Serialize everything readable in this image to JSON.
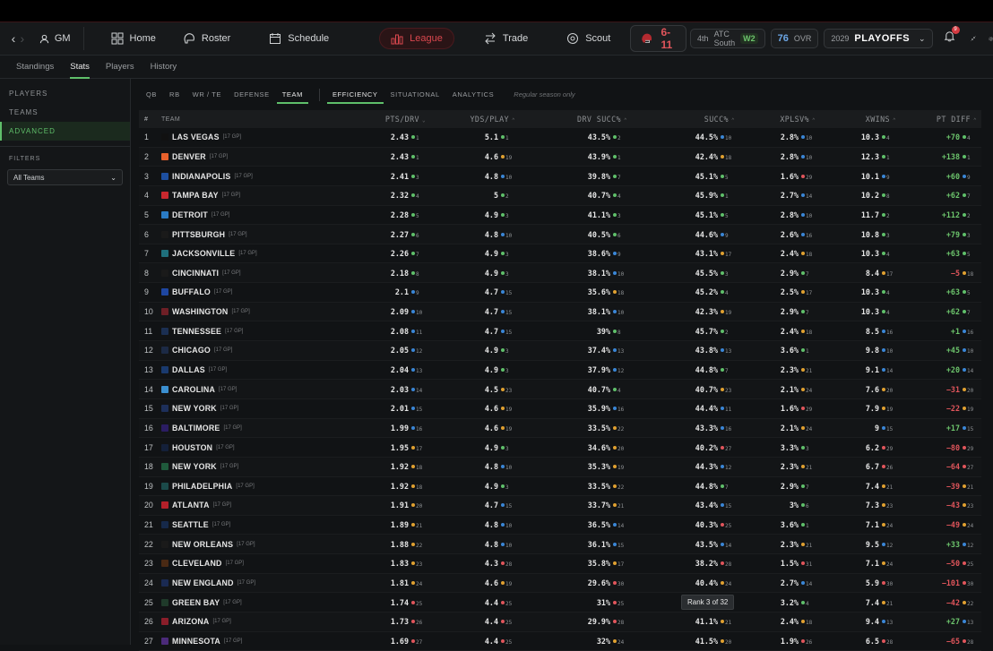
{
  "topbar": {
    "gm_label": "GM",
    "nav": [
      "Home",
      "Roster",
      "Schedule",
      "League",
      "Trade",
      "Scout"
    ],
    "record": "6-11",
    "standing_place": "4th",
    "standing_division": "ATC South",
    "streak": "W2",
    "ovr_value": "76",
    "ovr_label": "OVR",
    "season_year": "2029",
    "season_phase": "PLAYOFFS",
    "notification_count": "9"
  },
  "subtabs": [
    "Standings",
    "Stats",
    "Players",
    "History"
  ],
  "sidebar": {
    "items": [
      "PLAYERS",
      "TEAMS",
      "ADVANCED"
    ],
    "filters_label": "FILTERS",
    "team_filter": "All Teams"
  },
  "category_tabs": [
    "QB",
    "RB",
    "WR / TE",
    "DEFENSE",
    "TEAM"
  ],
  "sub_tabs": [
    "EFFICIENCY",
    "SITUATIONAL",
    "ANALYTICS"
  ],
  "note": "Regular season only",
  "columns": [
    "#",
    "TEAM",
    "PTS/DRV",
    "YDS/PLAY",
    "DRV SUCC%",
    "SUCC%",
    "XPLSV%",
    "XWINS",
    "PT DIFF"
  ],
  "rows": [
    {
      "n": "1",
      "team": "LAS VEGAS",
      "gp": "[17 GP]",
      "color": "#111111",
      "v": [
        [
          "2.43",
          "1"
        ],
        [
          "5.1",
          "1"
        ],
        [
          "43.5%",
          "2"
        ],
        [
          "44.5%",
          "10"
        ],
        [
          "2.8%",
          "10"
        ],
        [
          "10.3",
          "4"
        ],
        [
          "+70",
          "4"
        ]
      ]
    },
    {
      "n": "2",
      "team": "DENVER",
      "gp": "[17 GP]",
      "color": "#e8612c",
      "v": [
        [
          "2.43",
          "1"
        ],
        [
          "4.6",
          "19"
        ],
        [
          "43.9%",
          "1"
        ],
        [
          "42.4%",
          "18"
        ],
        [
          "2.8%",
          "10"
        ],
        [
          "12.3",
          "1"
        ],
        [
          "+138",
          "1"
        ]
      ]
    },
    {
      "n": "3",
      "team": "INDIANAPOLIS",
      "gp": "[17 GP]",
      "color": "#1d4fa0",
      "v": [
        [
          "2.41",
          "3"
        ],
        [
          "4.8",
          "10"
        ],
        [
          "39.8%",
          "7"
        ],
        [
          "45.1%",
          "5"
        ],
        [
          "1.6%",
          "29"
        ],
        [
          "10.1",
          "9"
        ],
        [
          "+60",
          "9"
        ]
      ]
    },
    {
      "n": "4",
      "team": "TAMPA BAY",
      "gp": "[17 GP]",
      "color": "#c8282e",
      "v": [
        [
          "2.32",
          "4"
        ],
        [
          "5",
          "2"
        ],
        [
          "40.7%",
          "4"
        ],
        [
          "45.9%",
          "1"
        ],
        [
          "2.7%",
          "14"
        ],
        [
          "10.2",
          "8"
        ],
        [
          "+62",
          "7"
        ]
      ]
    },
    {
      "n": "5",
      "team": "DETROIT",
      "gp": "[17 GP]",
      "color": "#2a7bc4",
      "v": [
        [
          "2.28",
          "5"
        ],
        [
          "4.9",
          "3"
        ],
        [
          "41.1%",
          "3"
        ],
        [
          "45.1%",
          "5"
        ],
        [
          "2.8%",
          "10"
        ],
        [
          "11.7",
          "2"
        ],
        [
          "+112",
          "2"
        ]
      ]
    },
    {
      "n": "6",
      "team": "PITTSBURGH",
      "gp": "[17 GP]",
      "color": "#1a1a1a",
      "v": [
        [
          "2.27",
          "6"
        ],
        [
          "4.8",
          "10"
        ],
        [
          "40.5%",
          "6"
        ],
        [
          "44.6%",
          "9"
        ],
        [
          "2.6%",
          "16"
        ],
        [
          "10.8",
          "3"
        ],
        [
          "+79",
          "3"
        ]
      ]
    },
    {
      "n": "7",
      "team": "JACKSONVILLE",
      "gp": "[17 GP]",
      "color": "#1f6f7c",
      "v": [
        [
          "2.26",
          "7"
        ],
        [
          "4.9",
          "3"
        ],
        [
          "38.6%",
          "9"
        ],
        [
          "43.1%",
          "17"
        ],
        [
          "2.4%",
          "18"
        ],
        [
          "10.3",
          "4"
        ],
        [
          "+63",
          "5"
        ]
      ]
    },
    {
      "n": "8",
      "team": "CINCINNATI",
      "gp": "[17 GP]",
      "color": "#1a1a1a",
      "v": [
        [
          "2.18",
          "8"
        ],
        [
          "4.9",
          "3"
        ],
        [
          "38.1%",
          "10"
        ],
        [
          "45.5%",
          "3"
        ],
        [
          "2.9%",
          "7"
        ],
        [
          "8.4",
          "17"
        ],
        [
          "−5",
          "18"
        ]
      ]
    },
    {
      "n": "9",
      "team": "BUFFALO",
      "gp": "[17 GP]",
      "color": "#1e46a0",
      "v": [
        [
          "2.1",
          "9"
        ],
        [
          "4.7",
          "15"
        ],
        [
          "35.6%",
          "18"
        ],
        [
          "45.2%",
          "4"
        ],
        [
          "2.5%",
          "17"
        ],
        [
          "10.3",
          "4"
        ],
        [
          "+63",
          "5"
        ]
      ]
    },
    {
      "n": "10",
      "team": "WASHINGTON",
      "gp": "[17 GP]",
      "color": "#6e1f26",
      "v": [
        [
          "2.09",
          "10"
        ],
        [
          "4.7",
          "15"
        ],
        [
          "38.1%",
          "10"
        ],
        [
          "42.3%",
          "19"
        ],
        [
          "2.9%",
          "7"
        ],
        [
          "10.3",
          "4"
        ],
        [
          "+62",
          "7"
        ]
      ]
    },
    {
      "n": "11",
      "team": "TENNESSEE",
      "gp": "[17 GP]",
      "color": "#1b2f52",
      "v": [
        [
          "2.08",
          "11"
        ],
        [
          "4.7",
          "15"
        ],
        [
          "39%",
          "8"
        ],
        [
          "45.7%",
          "2"
        ],
        [
          "2.4%",
          "18"
        ],
        [
          "8.5",
          "16"
        ],
        [
          "+1",
          "16"
        ]
      ]
    },
    {
      "n": "12",
      "team": "CHICAGO",
      "gp": "[17 GP]",
      "color": "#1c2a45",
      "v": [
        [
          "2.05",
          "12"
        ],
        [
          "4.9",
          "3"
        ],
        [
          "37.4%",
          "13"
        ],
        [
          "43.8%",
          "13"
        ],
        [
          "3.6%",
          "1"
        ],
        [
          "9.8",
          "10"
        ],
        [
          "+45",
          "10"
        ]
      ]
    },
    {
      "n": "13",
      "team": "DALLAS",
      "gp": "[17 GP]",
      "color": "#1a3a6e",
      "v": [
        [
          "2.04",
          "13"
        ],
        [
          "4.9",
          "3"
        ],
        [
          "37.9%",
          "12"
        ],
        [
          "44.8%",
          "7"
        ],
        [
          "2.3%",
          "21"
        ],
        [
          "9.1",
          "14"
        ],
        [
          "+20",
          "14"
        ]
      ]
    },
    {
      "n": "14",
      "team": "CAROLINA",
      "gp": "[17 GP]",
      "color": "#3b8fd0",
      "v": [
        [
          "2.03",
          "14"
        ],
        [
          "4.5",
          "23"
        ],
        [
          "40.7%",
          "4"
        ],
        [
          "40.7%",
          "23"
        ],
        [
          "2.1%",
          "24"
        ],
        [
          "7.6",
          "20"
        ],
        [
          "−31",
          "20"
        ]
      ]
    },
    {
      "n": "15",
      "team": "NEW YORK",
      "gp": "[17 GP]",
      "color": "#1d2f5a",
      "v": [
        [
          "2.01",
          "15"
        ],
        [
          "4.6",
          "19"
        ],
        [
          "35.9%",
          "16"
        ],
        [
          "44.4%",
          "11"
        ],
        [
          "1.6%",
          "29"
        ],
        [
          "7.9",
          "19"
        ],
        [
          "−22",
          "19"
        ]
      ]
    },
    {
      "n": "16",
      "team": "BALTIMORE",
      "gp": "[17 GP]",
      "color": "#2b1d63",
      "v": [
        [
          "1.99",
          "16"
        ],
        [
          "4.6",
          "19"
        ],
        [
          "33.5%",
          "22"
        ],
        [
          "43.3%",
          "16"
        ],
        [
          "2.1%",
          "24"
        ],
        [
          "9",
          "15"
        ],
        [
          "+17",
          "15"
        ]
      ]
    },
    {
      "n": "17",
      "team": "HOUSTON",
      "gp": "[17 GP]",
      "color": "#14203a",
      "v": [
        [
          "1.95",
          "17"
        ],
        [
          "4.9",
          "3"
        ],
        [
          "34.6%",
          "20"
        ],
        [
          "40.2%",
          "27"
        ],
        [
          "3.3%",
          "3"
        ],
        [
          "6.2",
          "29"
        ],
        [
          "−80",
          "29"
        ]
      ]
    },
    {
      "n": "18",
      "team": "NEW YORK",
      "gp": "[17 GP]",
      "color": "#1f5a3c",
      "v": [
        [
          "1.92",
          "18"
        ],
        [
          "4.8",
          "10"
        ],
        [
          "35.3%",
          "19"
        ],
        [
          "44.3%",
          "12"
        ],
        [
          "2.3%",
          "21"
        ],
        [
          "6.7",
          "26"
        ],
        [
          "−64",
          "27"
        ]
      ]
    },
    {
      "n": "19",
      "team": "PHILADELPHIA",
      "gp": "[17 GP]",
      "color": "#1b4a4a",
      "v": [
        [
          "1.92",
          "18"
        ],
        [
          "4.9",
          "3"
        ],
        [
          "33.5%",
          "22"
        ],
        [
          "44.8%",
          "7"
        ],
        [
          "2.9%",
          "7"
        ],
        [
          "7.4",
          "21"
        ],
        [
          "−39",
          "21"
        ]
      ]
    },
    {
      "n": "20",
      "team": "ATLANTA",
      "gp": "[17 GP]",
      "color": "#b3202a",
      "v": [
        [
          "1.91",
          "20"
        ],
        [
          "4.7",
          "15"
        ],
        [
          "33.7%",
          "21"
        ],
        [
          "43.4%",
          "15"
        ],
        [
          "3%",
          "6"
        ],
        [
          "7.3",
          "23"
        ],
        [
          "−43",
          "23"
        ]
      ]
    },
    {
      "n": "21",
      "team": "SEATTLE",
      "gp": "[17 GP]",
      "color": "#16294a",
      "v": [
        [
          "1.89",
          "21"
        ],
        [
          "4.8",
          "10"
        ],
        [
          "36.5%",
          "14"
        ],
        [
          "40.3%",
          "25"
        ],
        [
          "3.6%",
          "1"
        ],
        [
          "7.1",
          "24"
        ],
        [
          "−49",
          "24"
        ]
      ]
    },
    {
      "n": "22",
      "team": "NEW ORLEANS",
      "gp": "[17 GP]",
      "color": "#1a1a1a",
      "v": [
        [
          "1.88",
          "22"
        ],
        [
          "4.8",
          "10"
        ],
        [
          "36.1%",
          "15"
        ],
        [
          "43.5%",
          "14"
        ],
        [
          "2.3%",
          "21"
        ],
        [
          "9.5",
          "12"
        ],
        [
          "+33",
          "12"
        ]
      ]
    },
    {
      "n": "23",
      "team": "CLEVELAND",
      "gp": "[17 GP]",
      "color": "#4a2a14",
      "v": [
        [
          "1.83",
          "23"
        ],
        [
          "4.3",
          "28"
        ],
        [
          "35.8%",
          "17"
        ],
        [
          "38.2%",
          "28"
        ],
        [
          "1.5%",
          "31"
        ],
        [
          "7.1",
          "24"
        ],
        [
          "−50",
          "25"
        ]
      ]
    },
    {
      "n": "24",
      "team": "NEW ENGLAND",
      "gp": "[17 GP]",
      "color": "#1a2a52",
      "v": [
        [
          "1.81",
          "24"
        ],
        [
          "4.6",
          "19"
        ],
        [
          "29.6%",
          "30"
        ],
        [
          "40.4%",
          "24"
        ],
        [
          "2.7%",
          "14"
        ],
        [
          "5.9",
          "30"
        ],
        [
          "−101",
          "30"
        ]
      ]
    },
    {
      "n": "25",
      "team": "GREEN BAY",
      "gp": "[17 GP]",
      "color": "#1f3a2a",
      "v": [
        [
          "1.74",
          "25"
        ],
        [
          "4.4",
          "25"
        ],
        [
          "31%",
          "25"
        ],
        [
          "",
          ""
        ],
        [
          "3.2%",
          "4"
        ],
        [
          "7.4",
          "21"
        ],
        [
          "−42",
          "22"
        ]
      ]
    },
    {
      "n": "26",
      "team": "ARIZONA",
      "gp": "[17 GP]",
      "color": "#8a1e2a",
      "v": [
        [
          "1.73",
          "26"
        ],
        [
          "4.4",
          "25"
        ],
        [
          "29.9%",
          "28"
        ],
        [
          "41.1%",
          "21"
        ],
        [
          "2.4%",
          "18"
        ],
        [
          "9.4",
          "13"
        ],
        [
          "+27",
          "13"
        ]
      ]
    },
    {
      "n": "27",
      "team": "MINNESOTA",
      "gp": "[17 GP]",
      "color": "#4b2a7a",
      "v": [
        [
          "1.69",
          "27"
        ],
        [
          "4.4",
          "25"
        ],
        [
          "32%",
          "24"
        ],
        [
          "41.5%",
          "20"
        ],
        [
          "1.9%",
          "26"
        ],
        [
          "6.5",
          "28"
        ],
        [
          "−65",
          "28"
        ]
      ]
    }
  ],
  "tooltip": "Rank 3 of 32"
}
